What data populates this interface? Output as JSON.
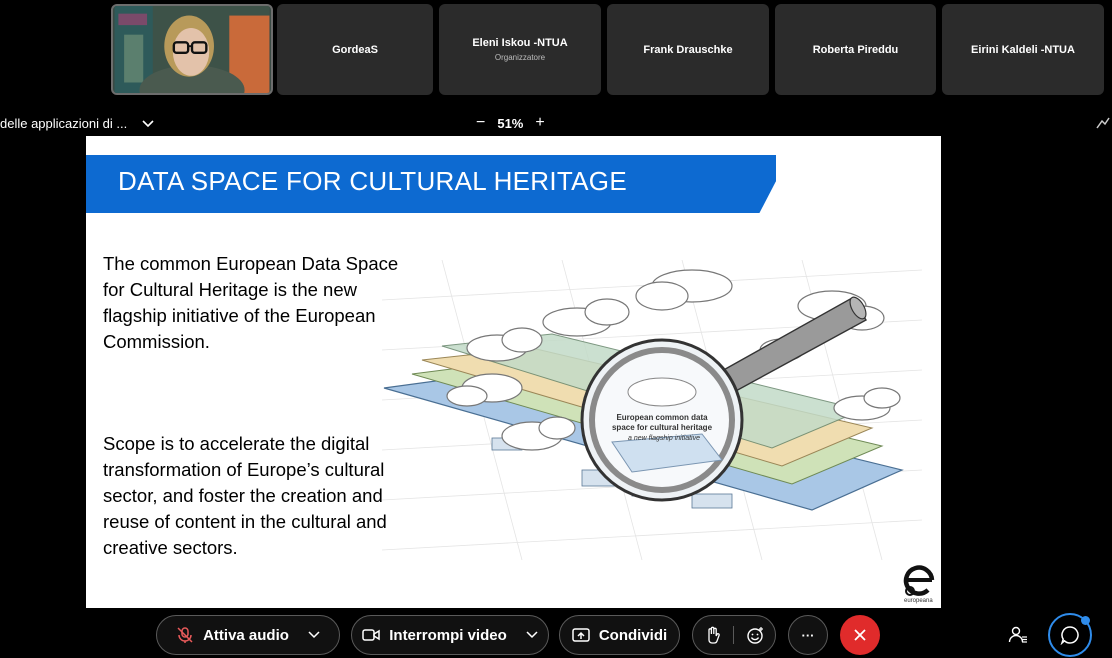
{
  "participants": [
    {
      "name": "GordeaS",
      "role": ""
    },
    {
      "name": "Eleni Iskou -NTUA",
      "role": "Organizzatore"
    },
    {
      "name": "Frank Drauschke",
      "role": ""
    },
    {
      "name": "Roberta Pireddu",
      "role": ""
    },
    {
      "name": "Eirini Kaldeli -NTUA",
      "role": ""
    }
  ],
  "share": {
    "title": "delle applicazioni di ...",
    "zoom": "51%",
    "zoom_out": "−",
    "zoom_in": "+"
  },
  "slide": {
    "title": "DATA SPACE FOR CULTURAL HERITAGE",
    "paragraph1": "The common European Data Space for Cultural Heritage is the new flagship initiative of the European Commission.",
    "paragraph2": "Scope is to accelerate the digital transformation of Europe’s cultural sector, and foster the creation and reuse of content in the cultural and creative sectors.",
    "magnifier_line1": "European common data",
    "magnifier_line2": "space for cultural heritage",
    "magnifier_line3": "a new flagship initiative",
    "logo_text": "europeana"
  },
  "controls": {
    "audio_label": "Attiva audio",
    "video_label": "Interrompi video",
    "share_label": "Condividi",
    "more_label": "···"
  },
  "colors": {
    "banner": "#0d6ad1",
    "end_call": "#e02b2b",
    "chat_ring": "#2f8ceb"
  }
}
